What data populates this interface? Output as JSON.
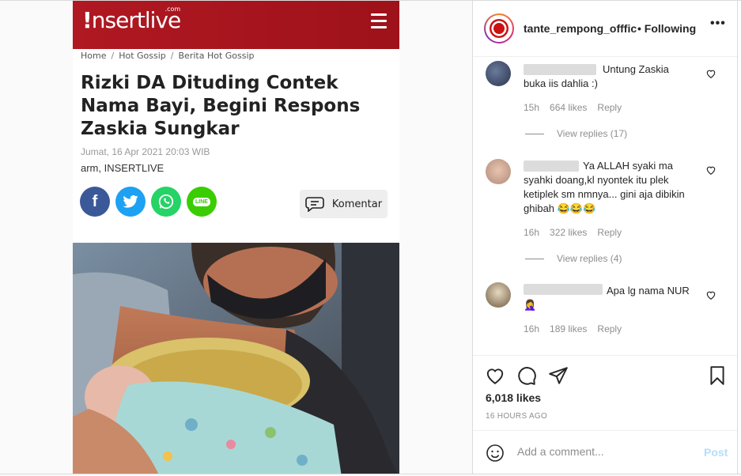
{
  "article": {
    "logo_text": "nsertlive",
    "logo_bang": "!",
    "logo_com": ".com",
    "breadcrumb": [
      "Home",
      "Hot Gossip",
      "Berita Hot Gossip"
    ],
    "breadcrumb_sep": "/",
    "headline": "Rizki DA Dituding Contek Nama Bayi, Begini Respons Zaskia Sungkar",
    "date": "Jumat, 16 Apr 2021 20:03 WIB",
    "author": "arm, INSERTLIVE",
    "share_line_label": "LINE",
    "comment_button_label": "Komentar",
    "colors": {
      "header": "#b01822",
      "facebook": "#3b5998",
      "twitter": "#1da1f2",
      "whatsapp": "#25d366",
      "line": "#3acd01"
    }
  },
  "post": {
    "username": "tante_rempong_offficial",
    "separator": "•",
    "follow_status": "Following",
    "more_label": "•••"
  },
  "comments": [
    {
      "text": "Untung Zaskia buka iis dahlia :)",
      "age": "15h",
      "likes": "664 likes",
      "reply_label": "Reply",
      "view_replies": "View replies (17)"
    },
    {
      "text": "Ya ALLAH syaki ma syahki doang,kl nyontek itu plek ketiplek sm nmnya... gini aja dibikin ghibah 😂😂😂",
      "age": "16h",
      "likes": "322 likes",
      "reply_label": "Reply",
      "view_replies": "View replies (4)"
    },
    {
      "text": "Apa lg nama NUR 🤦‍♀️",
      "age": "16h",
      "likes": "189 likes",
      "reply_label": "Reply"
    }
  ],
  "footer": {
    "likes": "6,018 likes",
    "time_ago": "16 HOURS AGO",
    "comment_placeholder": "Add a comment...",
    "post_label": "Post"
  }
}
